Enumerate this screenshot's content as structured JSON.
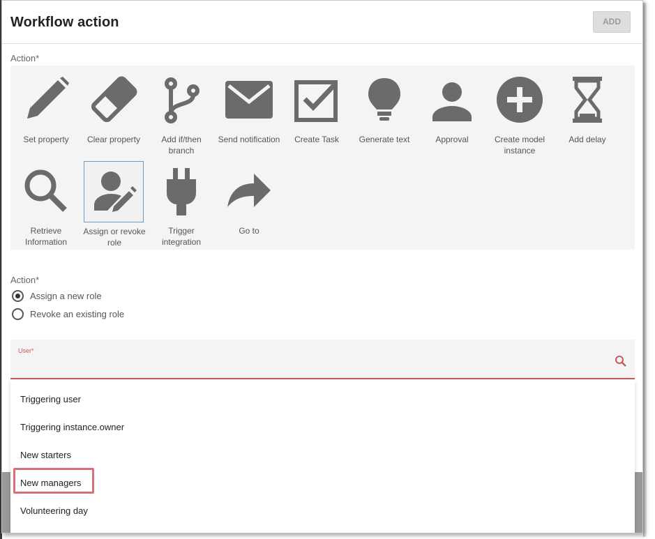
{
  "dialog": {
    "title": "Workflow action",
    "add_label": "ADD"
  },
  "action_section": {
    "label": "Action*",
    "tiles": [
      {
        "icon": "pencil-icon",
        "label": "Set property"
      },
      {
        "icon": "eraser-icon",
        "label": "Clear property"
      },
      {
        "icon": "branch-icon",
        "label": "Add if/then branch"
      },
      {
        "icon": "envelope-icon",
        "label": "Send notification"
      },
      {
        "icon": "checkbox-icon",
        "label": "Create Task"
      },
      {
        "icon": "lightbulb-icon",
        "label": "Generate text"
      },
      {
        "icon": "person-icon",
        "label": "Approval"
      },
      {
        "icon": "plus-circle-icon",
        "label": "Create model instance"
      },
      {
        "icon": "hourglass-icon",
        "label": "Add delay"
      },
      {
        "icon": "magnifier-icon",
        "label": "Retrieve Information"
      },
      {
        "icon": "person-edit-icon",
        "label": "Assign or revoke role",
        "selected": true
      },
      {
        "icon": "plug-icon",
        "label": "Trigger integration"
      },
      {
        "icon": "forward-arrow-icon",
        "label": "Go to"
      }
    ]
  },
  "role_action": {
    "label": "Action*",
    "options": [
      {
        "label": "Assign a new role",
        "checked": true
      },
      {
        "label": "Revoke an existing role",
        "checked": false
      }
    ]
  },
  "user_field": {
    "label": "User*",
    "value": "",
    "icon": "search-icon"
  },
  "user_dropdown": {
    "options": [
      "Triggering user",
      "Triggering instance.owner",
      "New starters",
      "New managers",
      "Volunteering day"
    ],
    "highlighted": "New managers"
  },
  "colors": {
    "icon_gray": "#6b6b6b",
    "error_red": "#c55a5a",
    "highlight_pink": "#d8707a",
    "selected_border": "#6d9ac9"
  }
}
